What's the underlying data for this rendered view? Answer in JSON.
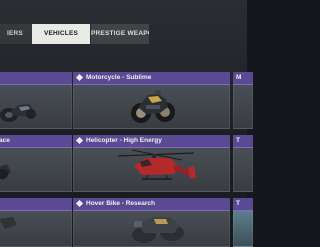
{
  "tabs": [
    {
      "label": "IERS"
    },
    {
      "label": "VEHICLES",
      "selected": true
    },
    {
      "label": "PRESTIGE WEAPON"
    }
  ],
  "cards": [
    {
      "title": "",
      "icon": "vehicle-art-motorcycle-dark"
    },
    {
      "title": "Motorcycle - Sublime",
      "icon": "motorcycle-art"
    },
    {
      "title": "M",
      "icon": "vehicle-art"
    },
    {
      "title": "ace",
      "icon": "vehicle-art"
    },
    {
      "title": "Helicopter - High Energy",
      "icon": "helicopter-art"
    },
    {
      "title": "T",
      "icon": "vehicle-art"
    },
    {
      "title": "",
      "icon": "vehicle-art"
    },
    {
      "title": "Hover Bike - Research",
      "icon": "hover-bike-art"
    },
    {
      "title": "T",
      "icon": "vehicle-art"
    }
  ],
  "colors": {
    "card_header": "#5b4a93",
    "selected_tab": "#e9eae6",
    "helicopter_red": "#b42a2a"
  }
}
